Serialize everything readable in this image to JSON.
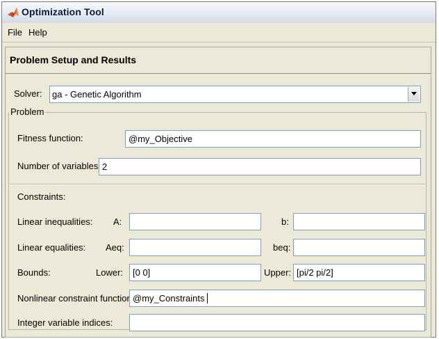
{
  "window": {
    "title": "Optimization Tool"
  },
  "menu": {
    "items": [
      "File",
      "Help"
    ]
  },
  "section": {
    "title": "Problem Setup and Results"
  },
  "solver": {
    "label": "Solver:",
    "value": "ga - Genetic Algorithm"
  },
  "problem": {
    "group_title": "Problem",
    "fitness_label": "Fitness function:",
    "fitness_value": "@my_Objective",
    "nvars_label": "Number of variables:",
    "nvars_value": "2"
  },
  "constraints": {
    "title": "Constraints:",
    "linear_ineq_label": "Linear inequalities:",
    "A_label": "A:",
    "A_value": "",
    "b_label": "b:",
    "b_value": "",
    "linear_eq_label": "Linear equalities:",
    "Aeq_label": "Aeq:",
    "Aeq_value": "",
    "beq_label": "beq:",
    "beq_value": "",
    "bounds_label": "Bounds:",
    "lower_label": "Lower:",
    "lower_value": "[0 0]",
    "upper_label": "Upper:",
    "upper_value": "[pi/2 pi/2]",
    "nonlinear_label": "Nonlinear constraint function:",
    "nonlinear_value": "@my_Constraints",
    "integer_label": "Integer variable indices:",
    "integer_value": ""
  },
  "icons": {
    "app": "matlab-logo-icon",
    "dropdown": "chevron-down-icon"
  }
}
